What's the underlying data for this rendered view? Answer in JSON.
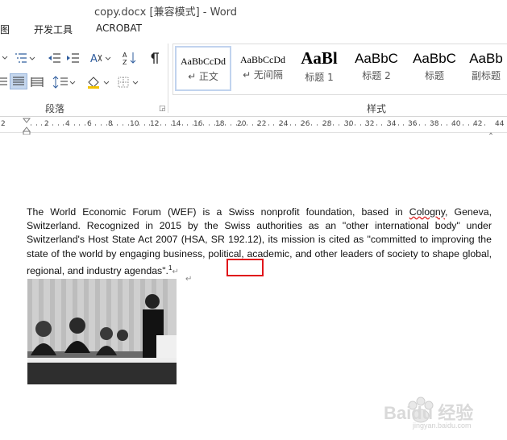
{
  "window": {
    "title": "copy.docx [兼容模式] - Word"
  },
  "tabs": [
    "图",
    "开发工具",
    "ACROBAT"
  ],
  "ribbon": {
    "paragraph_group_label": "段落",
    "styles_group_label": "样式",
    "styles": [
      {
        "sample": "AaBbCcDd",
        "name": "↵ 正文"
      },
      {
        "sample": "AaBbCcDd",
        "name": "↵ 无间隔"
      },
      {
        "sample": "AaBl",
        "name": "标题 1"
      },
      {
        "sample": "AaBbC",
        "name": "标题 2"
      },
      {
        "sample": "AaBbC",
        "name": "标题"
      },
      {
        "sample": "AaBb",
        "name": "副标题"
      }
    ]
  },
  "ruler": {
    "ticks": [
      "2",
      "2",
      "4",
      "6",
      "8",
      "10",
      "12",
      "14",
      "16",
      "18",
      "20",
      "22",
      "24",
      "26",
      "28",
      "30",
      "32",
      "34",
      "36",
      "38",
      "40",
      "42",
      "44"
    ]
  },
  "document": {
    "para_before_link": "The World Economic Forum (WEF) is a Swiss nonprofit foundation, based in ",
    "link_word": "Cologny",
    "para_after_link": ", Geneva, Switzerland. Recognized in 2015 by the Swiss authorities as an \"other international body\" under Switzerland's Host State Act 2007 (HSA, SR 192.12), its mission is cited as \"committed to improving the state of the world by engaging business, political, academic, and other leaders of society to shape global, regional, and industry agendas",
    "para_end": "\".",
    "footnote_ref": "1",
    "para_mark": "↵"
  },
  "watermark": {
    "brand": "Baidu 经验",
    "url": "jingyan.baidu.com"
  }
}
